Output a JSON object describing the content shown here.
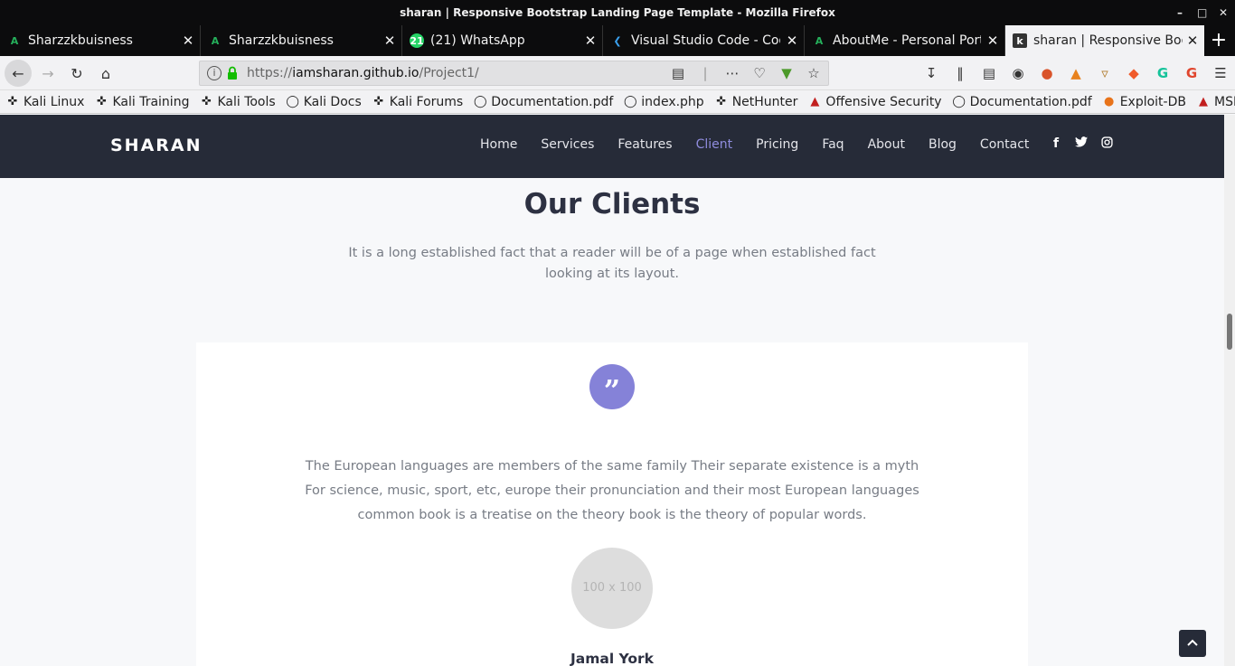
{
  "window": {
    "title": "sharan | Responsive Bootstrap Landing Page Template - Mozilla Firefox"
  },
  "tabs": [
    {
      "label": "Sharzzkbuisness",
      "icon": "arduino-a-icon",
      "active": false
    },
    {
      "label": "Sharzzkbuisness",
      "icon": "arduino-a-icon",
      "active": false
    },
    {
      "label": "(21) WhatsApp",
      "icon": "whatsapp-icon",
      "active": false
    },
    {
      "label": "Visual Studio Code - Cod",
      "icon": "vscode-icon",
      "active": false
    },
    {
      "label": "AboutMe - Personal Port",
      "icon": "arduino-a-icon",
      "active": false
    },
    {
      "label": "sharan | Responsive Boo",
      "icon": "k-favicon-icon",
      "active": true
    }
  ],
  "urlbar": {
    "prefix": "https://",
    "domain": "iamsharan.github.io",
    "path": "/Project1/"
  },
  "bookmarks": [
    {
      "label": "Kali Linux",
      "icon": "kali-dragon-icon"
    },
    {
      "label": "Kali Training",
      "icon": "kali-dragon-icon"
    },
    {
      "label": "Kali Tools",
      "icon": "kali-dragon-icon"
    },
    {
      "label": "Kali Docs",
      "icon": "globe-icon"
    },
    {
      "label": "Kali Forums",
      "icon": "kali-dragon-icon"
    },
    {
      "label": "Documentation.pdf",
      "icon": "globe-icon"
    },
    {
      "label": "index.php",
      "icon": "globe-icon"
    },
    {
      "label": "NetHunter",
      "icon": "kali-dragon-icon"
    },
    {
      "label": "Offensive Security",
      "icon": "offsec-icon"
    },
    {
      "label": "Documentation.pdf",
      "icon": "globe-icon"
    },
    {
      "label": "Exploit-DB",
      "icon": "exploitdb-icon"
    },
    {
      "label": "MSFU",
      "icon": "offsec-icon"
    }
  ],
  "site": {
    "brand": "SHARAN",
    "menu": [
      {
        "label": "Home",
        "active": false
      },
      {
        "label": "Services",
        "active": false
      },
      {
        "label": "Features",
        "active": false
      },
      {
        "label": "Client",
        "active": true
      },
      {
        "label": "Pricing",
        "active": false
      },
      {
        "label": "Faq",
        "active": false
      },
      {
        "label": "About",
        "active": false
      },
      {
        "label": "Blog",
        "active": false
      },
      {
        "label": "Contact",
        "active": false
      }
    ],
    "socials": [
      {
        "icon": "facebook-icon",
        "glyph": "f"
      },
      {
        "icon": "twitter-icon",
        "glyph": "🐦"
      },
      {
        "icon": "instagram-icon",
        "glyph": "◎"
      }
    ]
  },
  "clients": {
    "title": "Our Clients",
    "subtitle": "It is a long established fact that a reader will be of a page when established fact looking at its layout.",
    "quote_glyph": "”",
    "testimonial": "The European languages are members of the same family Their separate existence is a myth For science, music, sport, etc, europe their pronunciation and their most European languages common book is a treatise on the theory book is the theory of popular words.",
    "avatar_placeholder": "100 x 100",
    "name": "Jamal York"
  },
  "colors": {
    "header_bg": "#262b38",
    "accent": "#8582d8",
    "page_bg": "#f7f8fa"
  }
}
